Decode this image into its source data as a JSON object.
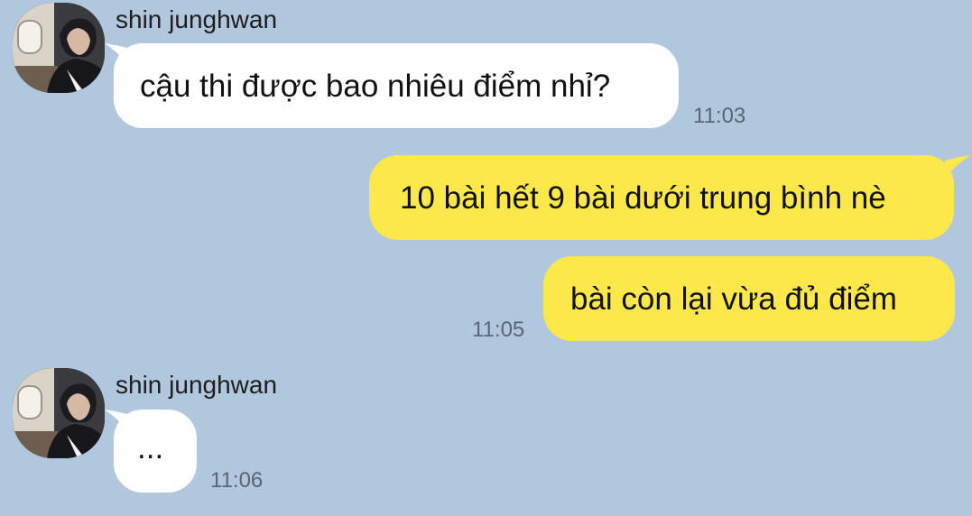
{
  "colors": {
    "background": "#b1c7dd",
    "incoming_bubble": "#ffffff",
    "outgoing_bubble": "#fce84a",
    "timestamp": "#5a6673"
  },
  "messages": [
    {
      "direction": "incoming",
      "sender": "shin junghwan",
      "avatar_icon": "profile-photo",
      "text": "cậu thi được bao nhiêu điểm nhỉ?",
      "time": "11:03"
    },
    {
      "direction": "outgoing",
      "text": "10 bài hết 9 bài dưới trung bình nè",
      "time": ""
    },
    {
      "direction": "outgoing",
      "text": "bài còn lại vừa đủ điểm",
      "time": "11:05"
    },
    {
      "direction": "incoming",
      "sender": "shin junghwan",
      "avatar_icon": "profile-photo",
      "text": "...",
      "time": "11:06"
    }
  ]
}
